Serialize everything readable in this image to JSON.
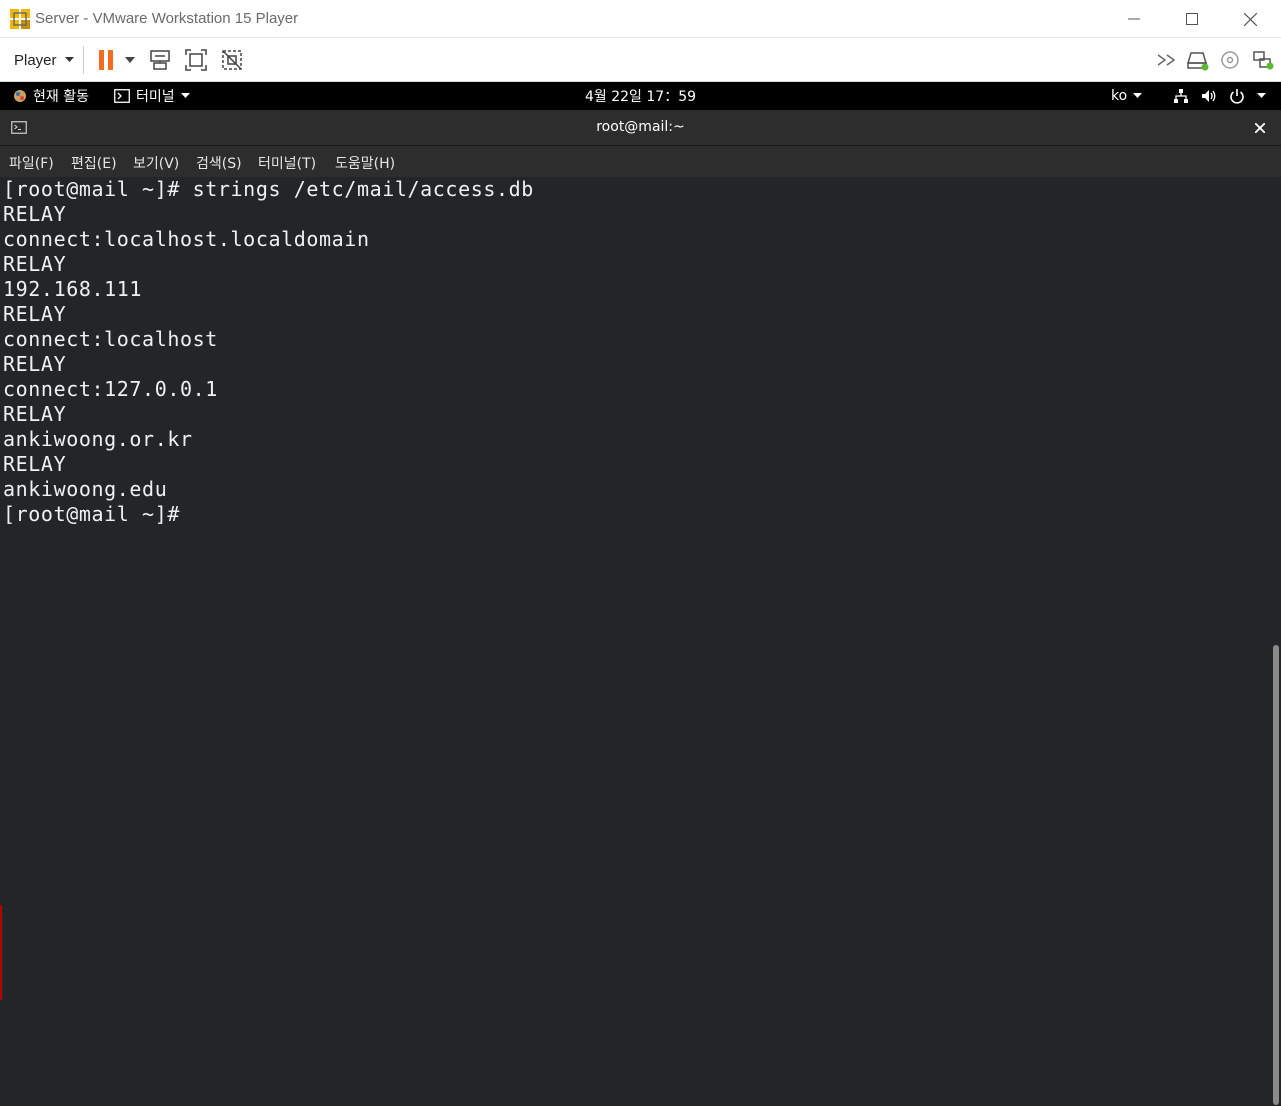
{
  "window": {
    "title": "Server - VMware Workstation 15 Player"
  },
  "toolbar": {
    "player_label": "Player"
  },
  "topbar": {
    "activities_label": "현재 활동",
    "app_label": "터미널",
    "datetime": "4월 22일  17：59",
    "input_method": "ko"
  },
  "terminal": {
    "title": "root@mail:~",
    "menu": [
      "파일(F)",
      "편집(E)",
      "보기(V)",
      "검색(S)",
      "터미널(T)",
      "도움말(H)"
    ],
    "lines": [
      "[root@mail ~]# strings /etc/mail/access.db",
      "RELAY",
      "connect:localhost.localdomain",
      "RELAY",
      "192.168.111",
      "RELAY",
      "connect:localhost",
      "RELAY",
      "connect:127.0.0.1",
      "RELAY",
      "ankiwoong.or.kr",
      "RELAY",
      "ankiwoong.edu",
      "[root@mail ~]#"
    ]
  },
  "colors": {
    "terminal_bg": "#232629",
    "terminal_fg": "#f0f0f0",
    "pause_orange": "#f26b21",
    "vmware_yellow": "#f2b705",
    "topbar_bg": "#000000"
  }
}
